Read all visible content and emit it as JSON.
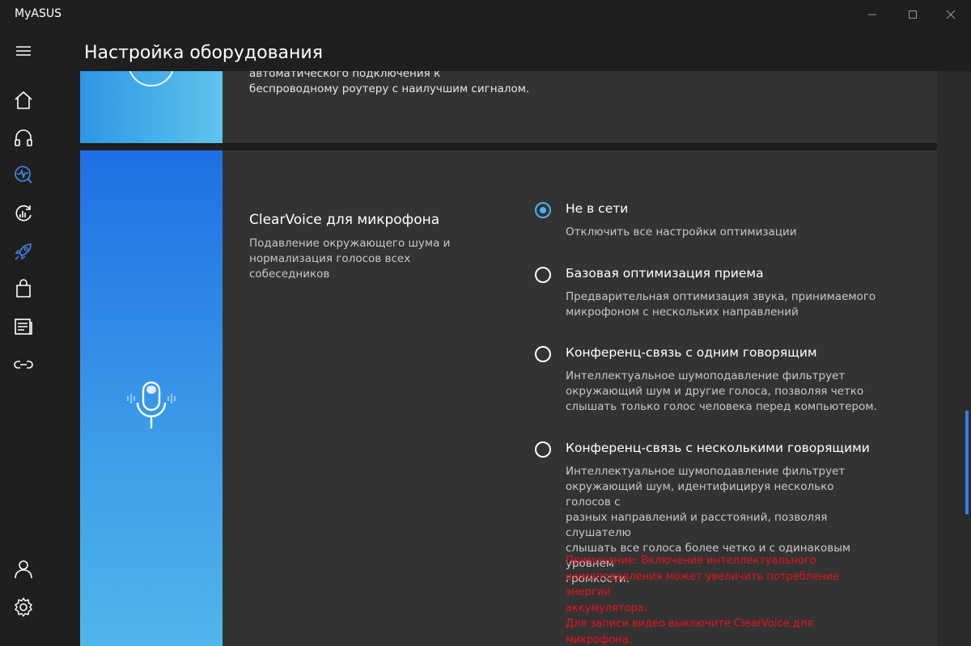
{
  "app": {
    "title": "MyASUS"
  },
  "window_controls": [
    "minimize-icon",
    "maximize-icon",
    "close-icon"
  ],
  "sidebar": {
    "menu_icon": "hamburger-menu-icon",
    "items": [
      {
        "icon": "home-icon"
      },
      {
        "icon": "headset-icon"
      },
      {
        "icon": "diagnostics-icon"
      },
      {
        "icon": "refresh-chart-icon"
      },
      {
        "icon": "rocket-icon"
      },
      {
        "icon": "shopping-bag-icon"
      },
      {
        "icon": "news-icon"
      },
      {
        "icon": "link-icon"
      }
    ],
    "bottom_items": [
      {
        "icon": "user-icon"
      },
      {
        "icon": "settings-icon"
      }
    ]
  },
  "header": {
    "title": "Настройка оборудования"
  },
  "card_wifi": {
    "text_line1": "автоматического подключения к",
    "text_line2": "беспроводному роутеру с наилучшим сигналом."
  },
  "card_clearvoice": {
    "icon": "microphone-icon",
    "title": "ClearVoice для микрофона",
    "desc_line1": "Подавление окружающего шума и",
    "desc_line2": "нормализация голосов всех собеседников",
    "options": [
      {
        "label": "Не в сети",
        "selected": true,
        "desc": [
          "Отключить все настройки оптимизации"
        ]
      },
      {
        "label": "Базовая оптимизация приема",
        "selected": false,
        "desc": [
          "Предварительная оптимизация звука, принимаемого",
          "микрофоном с нескольких направлений"
        ]
      },
      {
        "label": "Конференц-связь с одним говорящим",
        "selected": false,
        "desc": [
          "Интеллектуальное шумоподавление фильтрует",
          "окружающий шум и другие голоса, позволяя четко",
          "слышать только голос человека перед компьютером."
        ]
      },
      {
        "label": "Конференц-связь с несколькими говорящими",
        "selected": false,
        "desc": [
          "Интеллектуальное шумоподавление фильтрует",
          "окружающий шум, идентифицируя несколько голосов с",
          "разных направлений и расстояний, позволяя слушателю",
          "слышать все голоса более четко и с одинаковым уровнем",
          "громкости."
        ]
      }
    ],
    "note": [
      "Примечание: Включение интеллектуального",
      "шумоподавления может увеличить потребление энергии",
      "аккумулятора.",
      "Для записи видео выключите ClearVoice для микрофона."
    ]
  },
  "colors": {
    "background": "#1f1f1f",
    "card": "#333333",
    "accent_blue": "#4fb3f0",
    "note_red": "#e8121b",
    "rocket_blue": "#3a8ef0"
  }
}
